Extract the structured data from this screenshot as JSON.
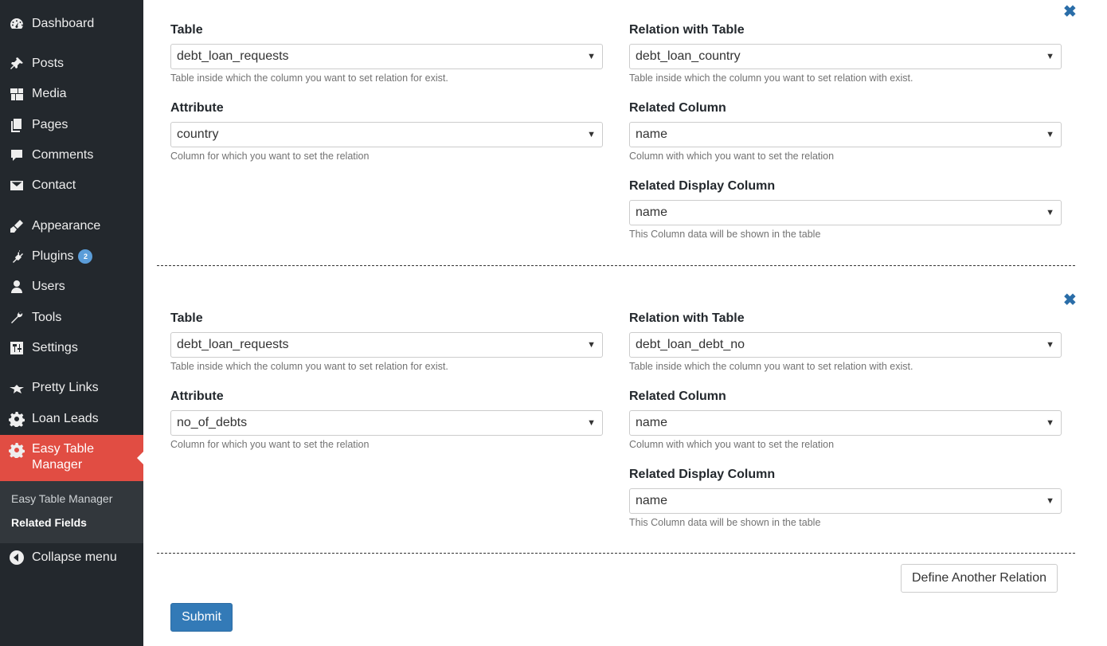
{
  "sidebar": {
    "items": [
      {
        "label": "Dashboard",
        "icon": "dashboard-icon"
      },
      {
        "label": "Posts",
        "icon": "pin-icon"
      },
      {
        "label": "Media",
        "icon": "media-icon"
      },
      {
        "label": "Pages",
        "icon": "pages-icon"
      },
      {
        "label": "Comments",
        "icon": "comment-icon"
      },
      {
        "label": "Contact",
        "icon": "mail-icon"
      },
      {
        "label": "Appearance",
        "icon": "brush-icon"
      },
      {
        "label": "Plugins",
        "icon": "plug-icon",
        "badge": "2"
      },
      {
        "label": "Users",
        "icon": "user-icon"
      },
      {
        "label": "Tools",
        "icon": "wrench-icon"
      },
      {
        "label": "Settings",
        "icon": "settings-icon"
      },
      {
        "label": "Pretty Links",
        "icon": "star-icon"
      },
      {
        "label": "Loan Leads",
        "icon": "gear-icon"
      },
      {
        "label": "Easy Table Manager",
        "icon": "gear-icon"
      },
      {
        "label": "Collapse menu",
        "icon": "collapse-icon"
      }
    ],
    "submenu": [
      {
        "label": "Easy Table Manager"
      },
      {
        "label": "Related Fields"
      }
    ]
  },
  "relations": [
    {
      "table_label": "Table",
      "table_value": "debt_loan_requests",
      "table_help": "Table inside which the column you want to set relation for exist.",
      "attribute_label": "Attribute",
      "attribute_value": "country",
      "attribute_help": "Column for which you want to set the relation",
      "relation_table_label": "Relation with Table",
      "relation_table_value": "debt_loan_country",
      "relation_table_help": "Table inside which the column you want to set relation with exist.",
      "related_column_label": "Related Column",
      "related_column_value": "name",
      "related_column_help": "Column with which you want to set the relation",
      "related_display_label": "Related Display Column",
      "related_display_value": "name",
      "related_display_help": "This Column data will be shown in the table"
    },
    {
      "table_label": "Table",
      "table_value": "debt_loan_requests",
      "table_help": "Table inside which the column you want to set relation for exist.",
      "attribute_label": "Attribute",
      "attribute_value": "no_of_debts",
      "attribute_help": "Column for which you want to set the relation",
      "relation_table_label": "Relation with Table",
      "relation_table_value": "debt_loan_debt_no",
      "relation_table_help": "Table inside which the column you want to set relation with exist.",
      "related_column_label": "Related Column",
      "related_column_value": "name",
      "related_column_help": "Column with which you want to set the relation",
      "related_display_label": "Related Display Column",
      "related_display_value": "name",
      "related_display_help": "This Column data will be shown in the table"
    }
  ],
  "buttons": {
    "define_another": "Define Another Relation",
    "submit": "Submit"
  },
  "symbols": {
    "close": "✖",
    "arrow": "▼"
  },
  "colors": {
    "sidebar_bg": "#23282d",
    "active_menu": "#e14d43",
    "submit": "#337ab7",
    "close_icon": "#2a6da8"
  }
}
